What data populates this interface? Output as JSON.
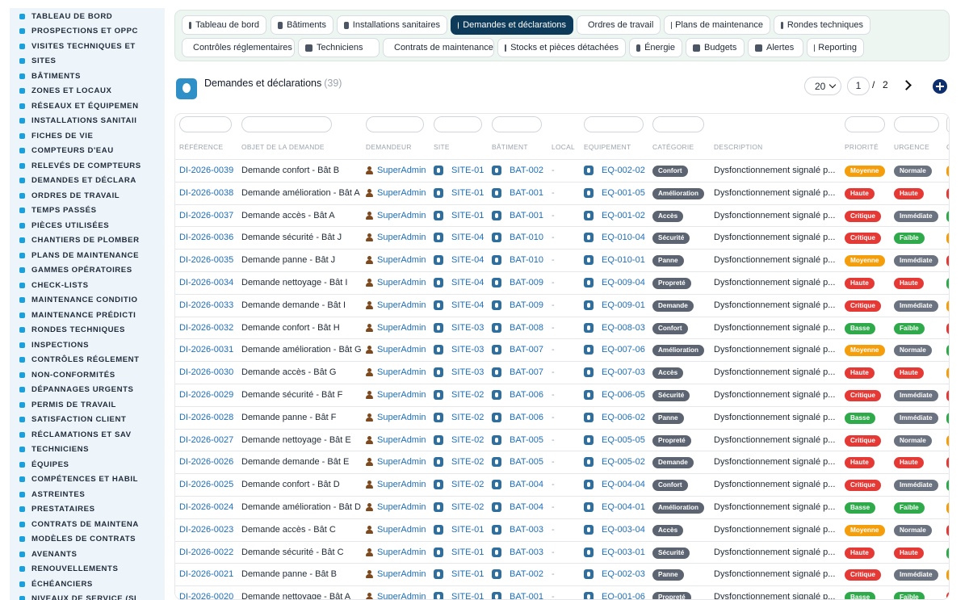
{
  "sidebar": {
    "items": [
      {
        "label": "TABLEAU DE BORD",
        "icon": "gauge-icon"
      },
      {
        "label": "PROSPECTIONS ET OPPC",
        "icon": "target-icon"
      },
      {
        "label": "VISITES TECHNIQUES ET",
        "icon": "clipboard-icon"
      },
      {
        "label": "SITES",
        "icon": "map-pin-icon"
      },
      {
        "label": "BÂTIMENTS",
        "icon": "building-icon"
      },
      {
        "label": "ZONES ET LOCAUX",
        "icon": "layers-icon"
      },
      {
        "label": "RÉSEAUX ET ÉQUIPEMEN",
        "icon": "network-icon"
      },
      {
        "label": "INSTALLATIONS SANITAII",
        "icon": "cogs-icon"
      },
      {
        "label": "FICHES DE VIE",
        "icon": "history-icon"
      },
      {
        "label": "COMPTEURS D'EAU",
        "icon": "meter-icon"
      },
      {
        "label": "RELEVÉS DE COMPTEURS",
        "icon": "list-icon"
      },
      {
        "label": "DEMANDES ET DÉCLARA",
        "icon": "question-icon"
      },
      {
        "label": "ORDRES DE TRAVAIL",
        "icon": "clipboard-check-icon"
      },
      {
        "label": "TEMPS PASSÉS",
        "icon": "clock-icon"
      },
      {
        "label": "PIÈCES UTILISÉES",
        "icon": "box-icon"
      },
      {
        "label": "CHANTIERS DE PLOMBER",
        "icon": "wrench-icon"
      },
      {
        "label": "PLANS DE MAINTENANCE",
        "icon": "calendar-icon"
      },
      {
        "label": "GAMMES OPÉRATOIRES",
        "icon": "tasks-icon"
      },
      {
        "label": "CHECK-LISTS",
        "icon": "checklist-icon"
      },
      {
        "label": "MAINTENANCE CONDITIO",
        "icon": "thermometer-icon"
      },
      {
        "label": "MAINTENANCE PRÉDICTI",
        "icon": "chart-icon"
      },
      {
        "label": "RONDES TECHNIQUES",
        "icon": "route-icon"
      },
      {
        "label": "INSPECTIONS",
        "icon": "search-icon"
      },
      {
        "label": "CONTRÔLES RÉGLEMENT",
        "icon": "shield-icon"
      },
      {
        "label": "NON-CONFORMITÉS",
        "icon": "alert-circle-icon"
      },
      {
        "label": "DÉPANNAGES URGENTS",
        "icon": "warning-icon"
      },
      {
        "label": "PERMIS DE TRAVAIL",
        "icon": "id-card-icon"
      },
      {
        "label": "SATISFACTION CLIENT",
        "icon": "smile-icon"
      },
      {
        "label": "RÉCLAMATIONS ET SAV",
        "icon": "comments-icon"
      },
      {
        "label": "TECHNICIENS",
        "icon": "hard-hat-icon"
      },
      {
        "label": "ÉQUIPES",
        "icon": "users-icon"
      },
      {
        "label": "COMPÉTENCES ET HABIL",
        "icon": "certificate-icon"
      },
      {
        "label": "ASTREINTES",
        "icon": "phone-icon"
      },
      {
        "label": "PRESTATAIRES",
        "icon": "handshake-icon"
      },
      {
        "label": "CONTRATS DE MAINTENA",
        "icon": "file-contract-icon"
      },
      {
        "label": "MODÈLES DE CONTRATS",
        "icon": "file-icon"
      },
      {
        "label": "AVENANTS",
        "icon": "file-edit-icon"
      },
      {
        "label": "RENOUVELLEMENTS",
        "icon": "refresh-icon"
      },
      {
        "label": "ÉCHÉANCIERS",
        "icon": "calendar-alt-icon"
      },
      {
        "label": "NIVEAUX DE SERVICE (SL",
        "icon": "sliders-icon"
      }
    ]
  },
  "tabs": [
    {
      "label": "Tableau de bord",
      "active": false
    },
    {
      "label": "Bâtiments",
      "active": false
    },
    {
      "label": "Installations sanitaires",
      "active": false
    },
    {
      "label": "Demandes et déclarations",
      "active": true
    },
    {
      "label": "Ordres de travail",
      "active": false
    },
    {
      "label": "Plans de maintenance",
      "active": false
    },
    {
      "label": "Rondes techniques",
      "active": false
    },
    {
      "label": "Contrôles réglementaires",
      "active": false
    },
    {
      "label": "Techniciens",
      "active": false
    },
    {
      "label": "Contrats de maintenance",
      "active": false
    },
    {
      "label": "Stocks et pièces détachées",
      "active": false
    },
    {
      "label": "Énergie",
      "active": false
    },
    {
      "label": "Budgets",
      "active": false
    },
    {
      "label": "Alertes",
      "active": false
    },
    {
      "label": "Reporting",
      "active": false
    }
  ],
  "header": {
    "title": "Demandes et déclarations",
    "count": "(39)"
  },
  "pagination": {
    "per_page": "20",
    "current_page": "1",
    "separator": "/",
    "total_pages": "2"
  },
  "table": {
    "columns": [
      "RÉFÉRENCE",
      "OBJET DE LA DEMANDE",
      "DEMANDEUR",
      "SITE",
      "BÂTIMENT",
      "LOCAL",
      "EQUIPEMENT",
      "CATÉGORIE",
      "DESCRIPTION",
      "PRIORITÉ",
      "URGENCE",
      "C"
    ],
    "rows": [
      {
        "ref": "DI-2026-0039",
        "objet": "Demande confort - Bât B",
        "demandeur": "SuperAdmin",
        "site": "SITE-01",
        "batiment": "BAT-002",
        "local": "-",
        "equipement": "EQ-002-02",
        "categorie": "Confort",
        "description": "Dysfonctionnement signalé p...",
        "priorite": "Moyenne",
        "urgence": "Normale"
      },
      {
        "ref": "DI-2026-0038",
        "objet": "Demande amélioration - Bât A",
        "demandeur": "SuperAdmin",
        "site": "SITE-01",
        "batiment": "BAT-001",
        "local": "-",
        "equipement": "EQ-001-05",
        "categorie": "Amélioration",
        "description": "Dysfonctionnement signalé p...",
        "priorite": "Haute",
        "urgence": "Haute"
      },
      {
        "ref": "DI-2026-0037",
        "objet": "Demande accès - Bât A",
        "demandeur": "SuperAdmin",
        "site": "SITE-01",
        "batiment": "BAT-001",
        "local": "-",
        "equipement": "EQ-001-02",
        "categorie": "Accès",
        "description": "Dysfonctionnement signalé p...",
        "priorite": "Critique",
        "urgence": "Immédiate"
      },
      {
        "ref": "DI-2026-0036",
        "objet": "Demande sécurité - Bât J",
        "demandeur": "SuperAdmin",
        "site": "SITE-04",
        "batiment": "BAT-010",
        "local": "-",
        "equipement": "EQ-010-04",
        "categorie": "Sécurité",
        "description": "Dysfonctionnement signalé p...",
        "priorite": "Critique",
        "urgence": "Faible"
      },
      {
        "ref": "DI-2026-0035",
        "objet": "Demande panne - Bât J",
        "demandeur": "SuperAdmin",
        "site": "SITE-04",
        "batiment": "BAT-010",
        "local": "-",
        "equipement": "EQ-010-01",
        "categorie": "Panne",
        "description": "Dysfonctionnement signalé p...",
        "priorite": "Moyenne",
        "urgence": "Immédiate"
      },
      {
        "ref": "DI-2026-0034",
        "objet": "Demande nettoyage - Bât I",
        "demandeur": "SuperAdmin",
        "site": "SITE-04",
        "batiment": "BAT-009",
        "local": "-",
        "equipement": "EQ-009-04",
        "categorie": "Propreté",
        "description": "Dysfonctionnement signalé p...",
        "priorite": "Haute",
        "urgence": "Haute"
      },
      {
        "ref": "DI-2026-0033",
        "objet": "Demande demande - Bât I",
        "demandeur": "SuperAdmin",
        "site": "SITE-04",
        "batiment": "BAT-009",
        "local": "-",
        "equipement": "EQ-009-01",
        "categorie": "Demande",
        "description": "Dysfonctionnement signalé p...",
        "priorite": "Critique",
        "urgence": "Immédiate"
      },
      {
        "ref": "DI-2026-0032",
        "objet": "Demande confort - Bât H",
        "demandeur": "SuperAdmin",
        "site": "SITE-03",
        "batiment": "BAT-008",
        "local": "-",
        "equipement": "EQ-008-03",
        "categorie": "Confort",
        "description": "Dysfonctionnement signalé p...",
        "priorite": "Basse",
        "urgence": "Faible"
      },
      {
        "ref": "DI-2026-0031",
        "objet": "Demande amélioration - Bât G",
        "demandeur": "SuperAdmin",
        "site": "SITE-03",
        "batiment": "BAT-007",
        "local": "-",
        "equipement": "EQ-007-06",
        "categorie": "Amélioration",
        "description": "Dysfonctionnement signalé p...",
        "priorite": "Moyenne",
        "urgence": "Normale"
      },
      {
        "ref": "DI-2026-0030",
        "objet": "Demande accès - Bât G",
        "demandeur": "SuperAdmin",
        "site": "SITE-03",
        "batiment": "BAT-007",
        "local": "-",
        "equipement": "EQ-007-03",
        "categorie": "Accès",
        "description": "Dysfonctionnement signalé p...",
        "priorite": "Haute",
        "urgence": "Haute"
      },
      {
        "ref": "DI-2026-0029",
        "objet": "Demande sécurité - Bât F",
        "demandeur": "SuperAdmin",
        "site": "SITE-02",
        "batiment": "BAT-006",
        "local": "-",
        "equipement": "EQ-006-05",
        "categorie": "Sécurité",
        "description": "Dysfonctionnement signalé p...",
        "priorite": "Critique",
        "urgence": "Immédiate"
      },
      {
        "ref": "DI-2026-0028",
        "objet": "Demande panne - Bât F",
        "demandeur": "SuperAdmin",
        "site": "SITE-02",
        "batiment": "BAT-006",
        "local": "-",
        "equipement": "EQ-006-02",
        "categorie": "Panne",
        "description": "Dysfonctionnement signalé p...",
        "priorite": "Basse",
        "urgence": "Immédiate"
      },
      {
        "ref": "DI-2026-0027",
        "objet": "Demande nettoyage - Bât E",
        "demandeur": "SuperAdmin",
        "site": "SITE-02",
        "batiment": "BAT-005",
        "local": "-",
        "equipement": "EQ-005-05",
        "categorie": "Propreté",
        "description": "Dysfonctionnement signalé p...",
        "priorite": "Critique",
        "urgence": "Normale"
      },
      {
        "ref": "DI-2026-0026",
        "objet": "Demande demande - Bât E",
        "demandeur": "SuperAdmin",
        "site": "SITE-02",
        "batiment": "BAT-005",
        "local": "-",
        "equipement": "EQ-005-02",
        "categorie": "Demande",
        "description": "Dysfonctionnement signalé p...",
        "priorite": "Haute",
        "urgence": "Haute"
      },
      {
        "ref": "DI-2026-0025",
        "objet": "Demande confort - Bât D",
        "demandeur": "SuperAdmin",
        "site": "SITE-02",
        "batiment": "BAT-004",
        "local": "-",
        "equipement": "EQ-004-04",
        "categorie": "Confort",
        "description": "Dysfonctionnement signalé p...",
        "priorite": "Critique",
        "urgence": "Immédiate"
      },
      {
        "ref": "DI-2026-0024",
        "objet": "Demande amélioration - Bât D",
        "demandeur": "SuperAdmin",
        "site": "SITE-02",
        "batiment": "BAT-004",
        "local": "-",
        "equipement": "EQ-004-01",
        "categorie": "Amélioration",
        "description": "Dysfonctionnement signalé p...",
        "priorite": "Basse",
        "urgence": "Faible"
      },
      {
        "ref": "DI-2026-0023",
        "objet": "Demande accès - Bât C",
        "demandeur": "SuperAdmin",
        "site": "SITE-01",
        "batiment": "BAT-003",
        "local": "-",
        "equipement": "EQ-003-04",
        "categorie": "Accès",
        "description": "Dysfonctionnement signalé p...",
        "priorite": "Moyenne",
        "urgence": "Normale"
      },
      {
        "ref": "DI-2026-0022",
        "objet": "Demande sécurité - Bât C",
        "demandeur": "SuperAdmin",
        "site": "SITE-01",
        "batiment": "BAT-003",
        "local": "-",
        "equipement": "EQ-003-01",
        "categorie": "Sécurité",
        "description": "Dysfonctionnement signalé p...",
        "priorite": "Haute",
        "urgence": "Haute"
      },
      {
        "ref": "DI-2026-0021",
        "objet": "Demande panne - Bât B",
        "demandeur": "SuperAdmin",
        "site": "SITE-01",
        "batiment": "BAT-002",
        "local": "-",
        "equipement": "EQ-002-03",
        "categorie": "Panne",
        "description": "Dysfonctionnement signalé p...",
        "priorite": "Critique",
        "urgence": "Immédiate"
      },
      {
        "ref": "DI-2026-0020",
        "objet": "Demande nettoyage - Bât A",
        "demandeur": "SuperAdmin",
        "site": "SITE-01",
        "batiment": "BAT-001",
        "local": "-",
        "equipement": "EQ-001-06",
        "categorie": "Propreté",
        "description": "Dysfonctionnement signalé p...",
        "priorite": "Basse",
        "urgence": "Faible"
      }
    ]
  },
  "colors": {
    "accent": "#0e3b5a",
    "link": "#1e6fb8",
    "category": "#5b6470",
    "Moyenne": "#f59e0b",
    "Haute": "#e53935",
    "Critique": "#e53935",
    "Basse": "#2eaa4a",
    "Normale": "#6b7280",
    "Immédiate": "#6b7280",
    "Faible": "#2eaa4a"
  }
}
